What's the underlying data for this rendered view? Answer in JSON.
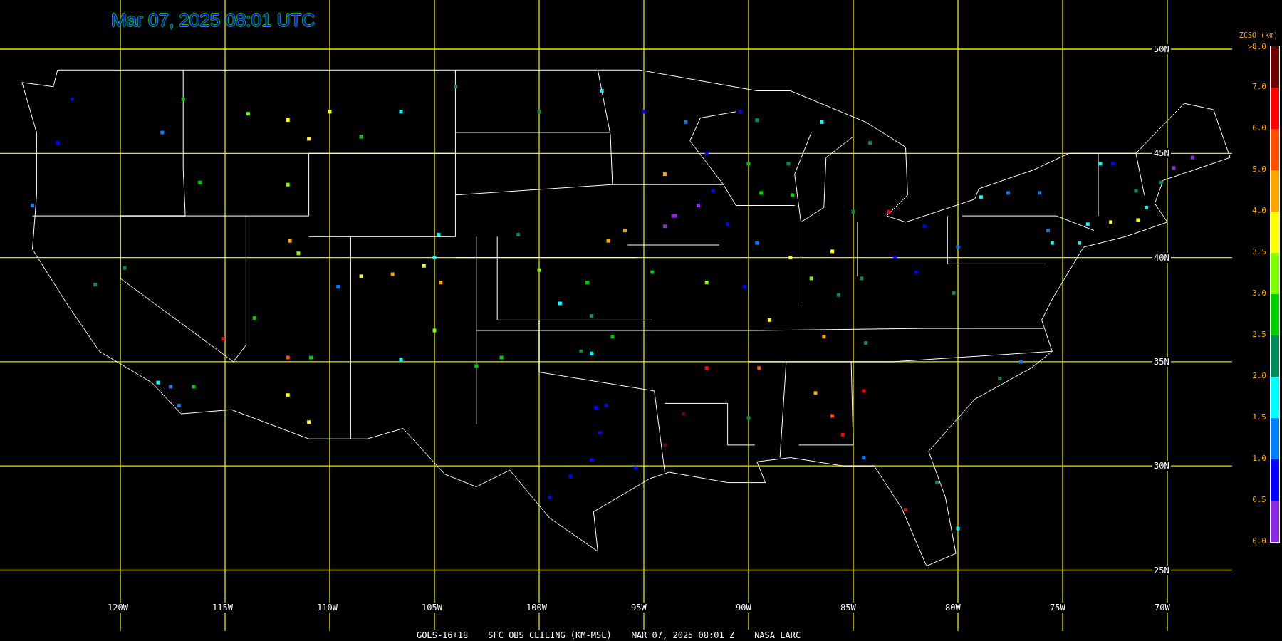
{
  "title": "Mar 07, 2025 08:01 UTC",
  "latitude_labels": [
    "50N",
    "45N",
    "40N",
    "35N",
    "30N",
    "25N"
  ],
  "longitude_labels": [
    "120W",
    "115W",
    "110W",
    "105W",
    "100W",
    "95W",
    "90W",
    "85W",
    "80W",
    "75W",
    "70W"
  ],
  "colorbar": {
    "title": "ZCSO (km)",
    "tick_labels": [
      ">8.0",
      "7.0",
      "6.0",
      "5.0",
      "4.0",
      "3.5",
      "3.0",
      "2.5",
      "2.0",
      "1.5",
      "1.0",
      "0.5",
      "0.0"
    ],
    "bands": [
      {
        "color": "#6b0000"
      },
      {
        "color": "#ff0000"
      },
      {
        "color": "#ff5000"
      },
      {
        "color": "#ffa500"
      },
      {
        "color": "#ffff00"
      },
      {
        "color": "#80ff00"
      },
      {
        "color": "#00cc00"
      },
      {
        "color": "#008b5a"
      },
      {
        "color": "#00ffff"
      },
      {
        "color": "#0080ff"
      },
      {
        "color": "#0000ff"
      },
      {
        "color": "#8a2be2"
      }
    ]
  },
  "footer": [
    "GOES-16+18",
    "SFC OBS CEILING (KM-MSL)",
    "MAR 07, 2025 08:01 Z",
    "NASA LARC"
  ]
}
